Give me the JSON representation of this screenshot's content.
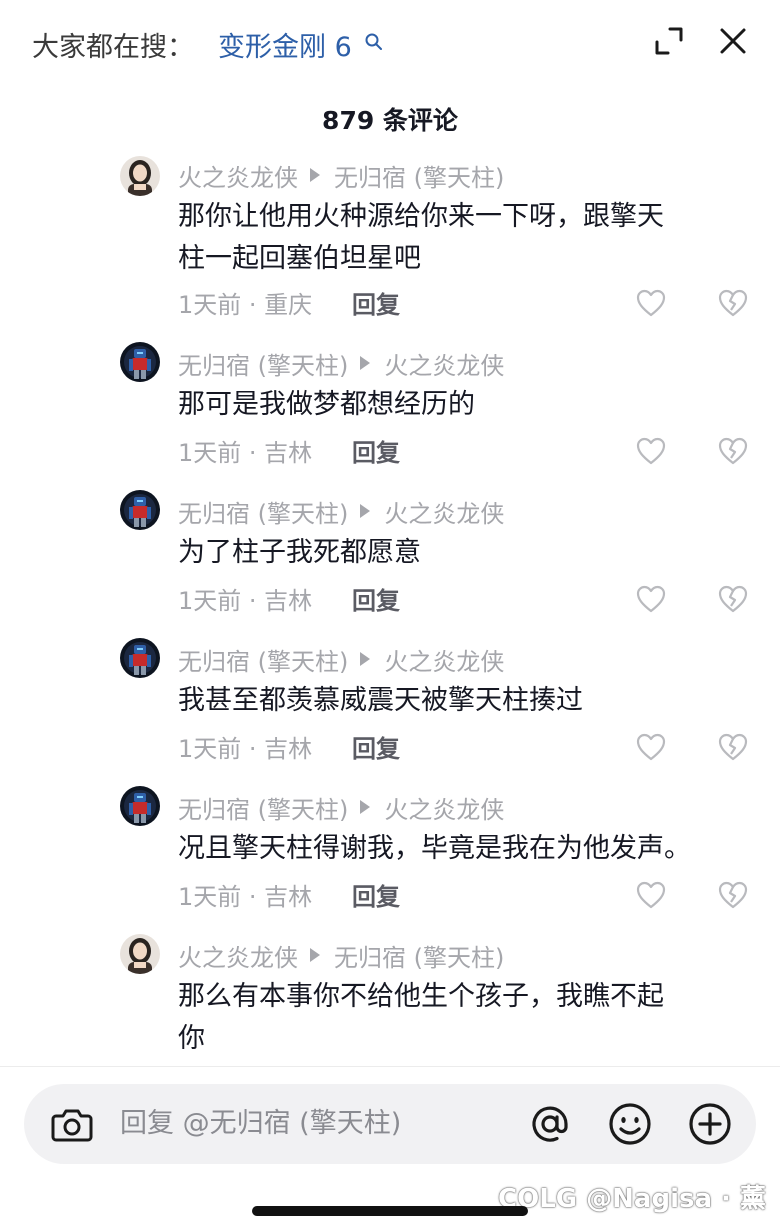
{
  "header": {
    "search_prefix": "大家都在搜：",
    "search_term": "变形金刚 6",
    "icons": [
      "search-icon",
      "expand-icon",
      "close-icon"
    ]
  },
  "comment_count": "879 条评论",
  "comments": [
    {
      "author": "火之炎龙侠",
      "reply_to": "无归宿 (擎天柱)",
      "text_line1": "那你让他用火种源给你来一下呀，跟擎天",
      "text_line2": "柱一起回塞伯坦星吧",
      "meta": "1天前 · 重庆",
      "reply_label": "回复"
    },
    {
      "author": "无归宿 (擎天柱)",
      "reply_to": "火之炎龙侠",
      "text_line1": "那可是我做梦都想经历的",
      "meta": "1天前 · 吉林",
      "reply_label": "回复"
    },
    {
      "author": "无归宿 (擎天柱)",
      "reply_to": "火之炎龙侠",
      "text_line1": "为了柱子我死都愿意",
      "meta": "1天前 · 吉林",
      "reply_label": "回复"
    },
    {
      "author": "无归宿 (擎天柱)",
      "reply_to": "火之炎龙侠",
      "text_line1": "我甚至都羡慕威震天被擎天柱揍过",
      "meta": "1天前 · 吉林",
      "reply_label": "回复"
    },
    {
      "author": "无归宿 (擎天柱)",
      "reply_to": "火之炎龙侠",
      "text_line1": "况且擎天柱得谢我，毕竟是我在为他发声。",
      "meta": "1天前 · 吉林",
      "reply_label": "回复"
    },
    {
      "author": "火之炎龙侠",
      "reply_to": "无归宿 (擎天柱)",
      "text_line1": "那么有本事你不给他生个孩子，我瞧不起",
      "text_line2": "你"
    }
  ],
  "input": {
    "placeholder": "回复 @无归宿 (擎天柱)",
    "icons": [
      "camera-icon",
      "at-icon",
      "emoji-icon",
      "plus-icon"
    ]
  },
  "watermark": "COLG @Nagisa · 薰",
  "colors": {
    "link_blue": "#2d5fa8",
    "muted_gray": "#a5a6ab",
    "text_dark": "#161823",
    "input_bg": "#f1f1f3"
  }
}
